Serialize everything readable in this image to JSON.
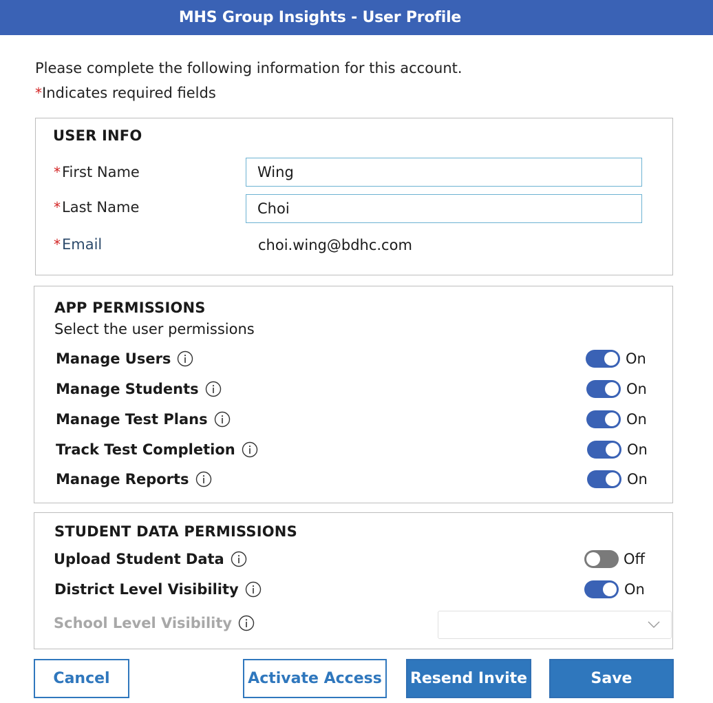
{
  "header": {
    "title": "MHS Group Insights - User Profile"
  },
  "intro": {
    "text": "Please complete the following information for this account.",
    "required_note": "Indicates required fields",
    "asterisk": "*"
  },
  "user_info": {
    "title": "USER INFO",
    "first_name": {
      "label": "First Name",
      "value": "Wing"
    },
    "last_name": {
      "label": "Last Name",
      "value": "Choi"
    },
    "email": {
      "label": "Email",
      "value": "choi.wing@bdhc.com"
    }
  },
  "app_permissions": {
    "title": "APP PERMISSIONS",
    "subtitle": "Select the user permissions",
    "items": [
      {
        "label": "Manage Users",
        "state": "On"
      },
      {
        "label": "Manage Students",
        "state": "On"
      },
      {
        "label": "Manage Test Plans",
        "state": "On"
      },
      {
        "label": "Track Test Completion",
        "state": "On"
      },
      {
        "label": "Manage Reports",
        "state": "On"
      }
    ]
  },
  "student_data_permissions": {
    "title": "STUDENT DATA PERMISSIONS",
    "items": [
      {
        "label": "Upload Student Data",
        "state": "Off"
      },
      {
        "label": "District Level Visibility",
        "state": "On"
      },
      {
        "label": "School Level Visibility",
        "state": ""
      }
    ],
    "school_select_value": ""
  },
  "buttons": {
    "cancel": "Cancel",
    "activate": "Activate Access",
    "resend": "Resend Invite",
    "save": "Save"
  },
  "colors": {
    "header_bg": "#3a62b5",
    "toggle_on": "#3a62b5",
    "toggle_off": "#7a7a7a",
    "button_primary": "#2f77bd",
    "required": "#d32424",
    "input_border": "#6cb2d2"
  },
  "icons": {
    "info": "info-circle-icon",
    "dropdown": "chevron-down-icon"
  }
}
